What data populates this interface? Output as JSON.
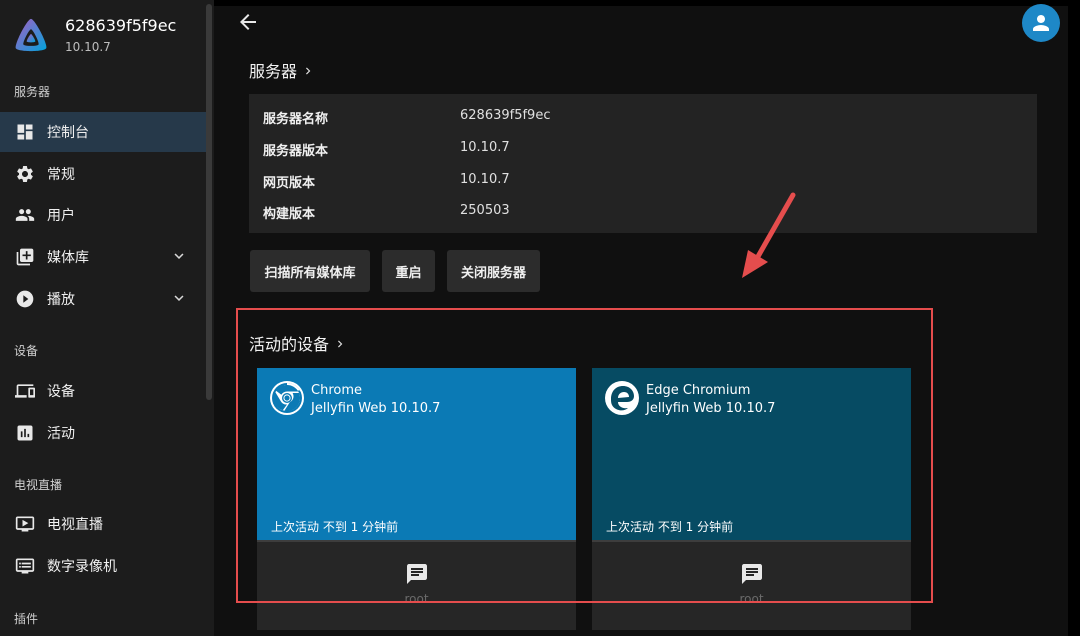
{
  "app": {
    "server_name": "628639f5f9ec",
    "version": "10.10.7"
  },
  "sidebar": {
    "sections": {
      "server": "服务器",
      "devices": "设备",
      "livetv": "电视直播",
      "plugins": "插件"
    },
    "items": [
      {
        "label": "控制台",
        "icon": "dashboard-icon",
        "active": true
      },
      {
        "label": "常规",
        "icon": "gear-icon"
      },
      {
        "label": "用户",
        "icon": "users-icon"
      },
      {
        "label": "媒体库",
        "icon": "library-add-icon",
        "expandable": true
      },
      {
        "label": "播放",
        "icon": "play-circle-icon",
        "expandable": true
      },
      {
        "label": "设备",
        "icon": "devices-icon"
      },
      {
        "label": "活动",
        "icon": "activity-chart-icon"
      },
      {
        "label": "电视直播",
        "icon": "live-tv-icon"
      },
      {
        "label": "数字录像机",
        "icon": "dvr-icon"
      }
    ]
  },
  "header": {
    "back_icon": "arrow-back-icon",
    "avatar_icon": "user-avatar-icon"
  },
  "server_section": {
    "title": "服务器",
    "rows": [
      {
        "key": "服务器名称",
        "value": "628639f5f9ec"
      },
      {
        "key": "服务器版本",
        "value": "10.10.7"
      },
      {
        "key": "网页版本",
        "value": "10.10.7"
      },
      {
        "key": "构建版本",
        "value": "250503"
      }
    ],
    "buttons": {
      "scan": "扫描所有媒体库",
      "restart": "重启",
      "shutdown": "关闭服务器"
    }
  },
  "devices_section": {
    "title": "活动的设备",
    "cards": [
      {
        "name": "Chrome",
        "client": "Jellyfin Web 10.10.7",
        "activity": "上次活动 不到 1 分钟前",
        "footer": "root",
        "color": "#0b7ab5",
        "icon": "chrome-icon"
      },
      {
        "name": "Edge Chromium",
        "client": "Jellyfin Web 10.10.7",
        "activity": "上次活动 不到 1 分钟前",
        "footer": "root",
        "color": "#064b63",
        "icon": "edge-icon"
      }
    ]
  },
  "colors": {
    "highlight": "#e54d4d",
    "active_nav": "#26394a",
    "avatar": "#1e88c7"
  }
}
